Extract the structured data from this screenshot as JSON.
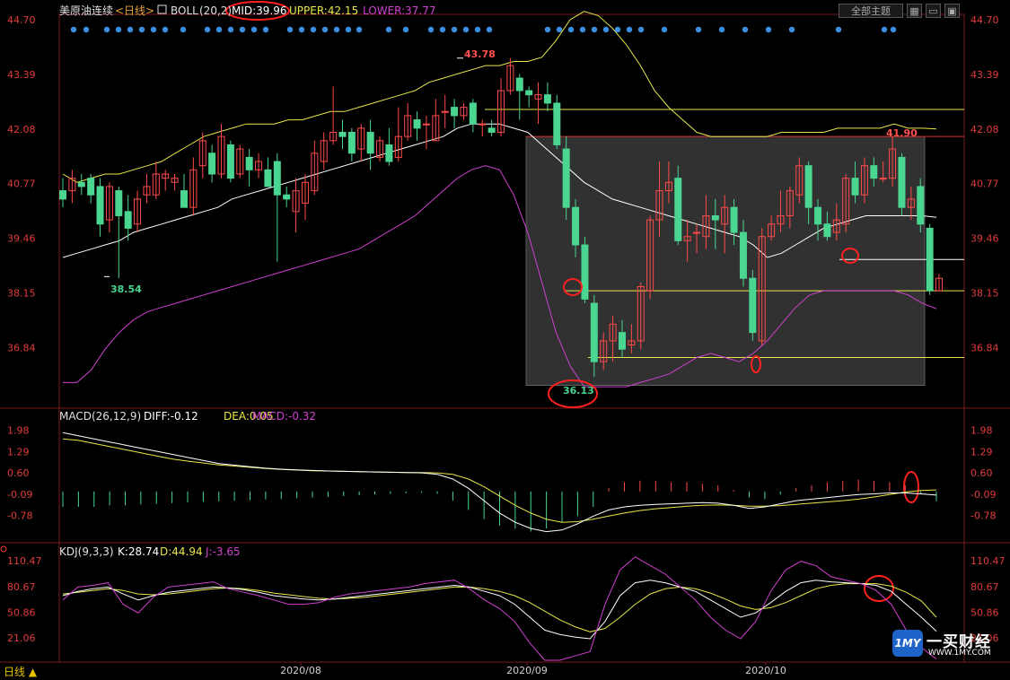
{
  "header": {
    "title": "美原油连续",
    "period_tag": "<日线>",
    "indicator_name": "BOLL",
    "indicator_params": "(20,2)",
    "mid_label": "MID:39.96",
    "upper_label": "UPPER:42.15",
    "lower_label": "LOWER:37.77",
    "theme_button": "全部主题"
  },
  "macd_header": {
    "name": "MACD(26,12,9)",
    "diff": "DIFF:-0.12",
    "dea": "DEA:0.05",
    "macd": "MACD:-0.32"
  },
  "kdj_header": {
    "name": "KDJ(9,3,3)",
    "k": "K:28.74",
    "d": "D:44.94",
    "j": "J:-3.65"
  },
  "annotations": {
    "high_label": "43.78",
    "low_label": "38.54",
    "recent_high_label": "41.90",
    "bottom_label": "36.13"
  },
  "bottom": {
    "period_tab": "日线 ▲"
  },
  "brand": {
    "logo": "1MY",
    "name": "一买财经",
    "url": "WWW.1MY.COM"
  },
  "colors": {
    "up": "#ff4a4a",
    "down": "#4ad590",
    "axis_text": "#e23b3b",
    "upper": "#e8e84a",
    "mid": "#ffffff",
    "lower": "#d040d0",
    "dots": "#3a8fe0"
  },
  "chart_data": [
    {
      "type": "candlestick",
      "title": "美原油连续",
      "x_labels": [
        "2020/08",
        "2020/09",
        "2020/10"
      ],
      "y_ticks": [
        44.7,
        43.39,
        42.08,
        40.77,
        39.46,
        38.15,
        36.84
      ],
      "ylim": [
        35.6,
        44.7
      ],
      "candles": [
        [
          40.6,
          40.4,
          40.9,
          40.2
        ],
        [
          40.6,
          40.9,
          41.1,
          40.3
        ],
        [
          40.8,
          40.7,
          41.0,
          40.5
        ],
        [
          40.9,
          40.5,
          41.0,
          40.3
        ],
        [
          40.7,
          39.8,
          40.9,
          39.5
        ],
        [
          39.9,
          40.7,
          40.8,
          39.6
        ],
        [
          40.6,
          40.0,
          40.7,
          38.5
        ],
        [
          40.1,
          39.7,
          40.5,
          39.4
        ],
        [
          39.8,
          40.4,
          40.6,
          39.6
        ],
        [
          40.5,
          40.7,
          41.0,
          40.3
        ],
        [
          40.5,
          41.0,
          41.3,
          40.4
        ],
        [
          40.9,
          41.0,
          41.1,
          40.6
        ],
        [
          40.8,
          40.9,
          41.0,
          40.6
        ],
        [
          40.6,
          40.2,
          41.0,
          40.2
        ],
        [
          40.2,
          41.1,
          41.4,
          40.0
        ],
        [
          41.2,
          41.8,
          42.0,
          40.9
        ],
        [
          41.5,
          41.0,
          41.7,
          40.8
        ],
        [
          41.0,
          41.9,
          42.2,
          40.9
        ],
        [
          41.7,
          40.9,
          41.8,
          40.8
        ],
        [
          41.0,
          41.6,
          41.7,
          40.9
        ],
        [
          41.4,
          41.1,
          41.6,
          40.7
        ],
        [
          41.1,
          41.3,
          41.5,
          40.9
        ],
        [
          41.1,
          40.7,
          41.4,
          40.7
        ],
        [
          41.3,
          40.5,
          41.5,
          38.9
        ],
        [
          40.5,
          40.4,
          40.7,
          40.2
        ],
        [
          40.1,
          40.6,
          40.9,
          39.6
        ],
        [
          40.3,
          40.8,
          41.0,
          39.9
        ],
        [
          40.6,
          41.5,
          41.8,
          40.5
        ],
        [
          41.3,
          41.8,
          42.0,
          41.1
        ],
        [
          41.8,
          42.0,
          43.1,
          41.7
        ],
        [
          42.0,
          41.9,
          42.3,
          41.6
        ],
        [
          42.0,
          41.5,
          42.1,
          41.3
        ],
        [
          41.6,
          42.1,
          42.2,
          41.3
        ],
        [
          42.0,
          41.5,
          42.3,
          41.1
        ],
        [
          41.4,
          41.8,
          41.9,
          41.3
        ],
        [
          41.7,
          41.3,
          42.1,
          41.2
        ],
        [
          41.4,
          41.9,
          42.6,
          41.3
        ],
        [
          41.9,
          42.4,
          42.7,
          41.8
        ],
        [
          42.3,
          42.1,
          42.5,
          41.8
        ],
        [
          42.2,
          42.2,
          42.4,
          41.6
        ],
        [
          41.8,
          42.4,
          42.8,
          41.8
        ],
        [
          42.5,
          42.5,
          42.9,
          42.1
        ],
        [
          42.6,
          42.4,
          42.8,
          42.1
        ],
        [
          42.4,
          42.6,
          42.7,
          42.3
        ],
        [
          42.7,
          42.2,
          42.8,
          42.0
        ],
        [
          42.2,
          42.2,
          42.3,
          41.9
        ],
        [
          42.1,
          42.0,
          42.3,
          41.9
        ],
        [
          42.0,
          43.0,
          43.3,
          41.9
        ],
        [
          43.0,
          43.6,
          43.78,
          42.9
        ],
        [
          43.3,
          43.0,
          43.4,
          42.3
        ],
        [
          43.0,
          42.9,
          43.1,
          42.6
        ],
        [
          42.8,
          42.9,
          43.2,
          42.2
        ],
        [
          42.9,
          42.7,
          43.2,
          42.5
        ],
        [
          42.7,
          41.7,
          42.9,
          41.6
        ],
        [
          41.6,
          40.2,
          41.9,
          39.9
        ],
        [
          40.2,
          39.3,
          40.4,
          39.0
        ],
        [
          39.3,
          38.0,
          39.5,
          37.9
        ],
        [
          37.9,
          36.5,
          38.1,
          36.13
        ],
        [
          36.5,
          37.0,
          37.2,
          36.3
        ],
        [
          37.0,
          37.4,
          37.6,
          36.5
        ],
        [
          37.2,
          36.8,
          37.5,
          36.6
        ],
        [
          36.9,
          37.0,
          37.4,
          36.7
        ],
        [
          37.0,
          38.3,
          38.4,
          36.8
        ],
        [
          38.2,
          39.9,
          40.0,
          38.0
        ],
        [
          39.9,
          40.6,
          41.3,
          39.5
        ],
        [
          40.6,
          40.8,
          41.3,
          40.3
        ],
        [
          40.9,
          39.4,
          41.2,
          39.3
        ],
        [
          39.4,
          39.5,
          39.9,
          38.9
        ],
        [
          39.6,
          39.6,
          39.8,
          39.1
        ],
        [
          39.5,
          40.0,
          40.5,
          39.2
        ],
        [
          40.0,
          39.9,
          40.4,
          39.2
        ],
        [
          39.8,
          40.2,
          40.5,
          39.1
        ],
        [
          40.2,
          39.6,
          40.4,
          39.3
        ],
        [
          39.6,
          38.5,
          39.9,
          38.3
        ],
        [
          38.5,
          37.2,
          38.7,
          37.0
        ],
        [
          37.0,
          39.5,
          39.7,
          36.9
        ],
        [
          39.5,
          39.8,
          40.0,
          39.4
        ],
        [
          39.8,
          40.0,
          40.6,
          39.6
        ],
        [
          40.0,
          40.6,
          40.7,
          39.7
        ],
        [
          40.5,
          41.2,
          41.4,
          40.3
        ],
        [
          41.2,
          40.2,
          41.3,
          39.8
        ],
        [
          40.2,
          39.8,
          40.4,
          39.4
        ],
        [
          39.8,
          39.5,
          40.1,
          39.4
        ],
        [
          39.6,
          39.9,
          40.3,
          39.4
        ],
        [
          39.8,
          40.9,
          41.0,
          39.6
        ],
        [
          40.9,
          40.5,
          41.3,
          40.3
        ],
        [
          40.5,
          41.2,
          41.4,
          40.3
        ],
        [
          41.2,
          40.9,
          41.4,
          40.7
        ],
        [
          40.9,
          40.9,
          41.3,
          40.8
        ],
        [
          40.9,
          41.6,
          41.9,
          40.7
        ],
        [
          41.4,
          40.2,
          41.5,
          40.0
        ],
        [
          40.2,
          40.4,
          40.7,
          39.9
        ],
        [
          40.7,
          39.8,
          40.9,
          39.6
        ],
        [
          39.7,
          38.2,
          39.8,
          38.1
        ],
        [
          38.2,
          38.5,
          38.6,
          38.2
        ]
      ],
      "boll_upper": [
        41.0,
        40.8,
        40.9,
        41.0,
        41.0,
        41.1,
        41.2,
        41.3,
        41.5,
        41.7,
        41.9,
        42.0,
        42.1,
        42.2,
        42.2,
        42.2,
        42.3,
        42.3,
        42.4,
        42.5,
        42.5,
        42.6,
        42.7,
        42.8,
        42.9,
        43.0,
        43.2,
        43.3,
        43.4,
        43.5,
        43.6,
        43.6,
        43.7,
        43.7,
        43.8,
        44.2,
        44.7,
        44.9,
        44.8,
        44.5,
        44.1,
        43.6,
        43.0,
        42.6,
        42.3,
        42.0,
        41.9,
        41.9,
        41.9,
        41.9,
        41.9,
        42.0,
        42.0,
        42.0,
        42.0,
        42.1,
        42.1,
        42.1,
        42.1,
        42.2,
        42.1,
        42.1,
        42.08
      ],
      "boll_mid": [
        39.0,
        39.1,
        39.2,
        39.3,
        39.4,
        39.6,
        39.7,
        39.8,
        39.9,
        40.0,
        40.1,
        40.2,
        40.4,
        40.5,
        40.6,
        40.7,
        40.8,
        40.9,
        41.0,
        41.1,
        41.2,
        41.3,
        41.4,
        41.5,
        41.6,
        41.7,
        41.8,
        41.9,
        42.1,
        42.2,
        42.2,
        42.2,
        42.1,
        42.0,
        41.7,
        41.4,
        41.1,
        40.8,
        40.6,
        40.4,
        40.3,
        40.2,
        40.1,
        40.0,
        39.9,
        39.8,
        39.7,
        39.6,
        39.5,
        39.3,
        39.0,
        39.1,
        39.3,
        39.5,
        39.7,
        39.8,
        39.9,
        40.0,
        40.0,
        40.0,
        40.0,
        40.0,
        39.96
      ],
      "boll_lower": [
        36.0,
        36.0,
        36.3,
        36.8,
        37.2,
        37.5,
        37.7,
        37.8,
        37.9,
        38.0,
        38.1,
        38.2,
        38.3,
        38.4,
        38.5,
        38.6,
        38.7,
        38.8,
        38.9,
        39.0,
        39.1,
        39.2,
        39.4,
        39.6,
        39.8,
        40.0,
        40.3,
        40.6,
        40.9,
        41.1,
        41.2,
        41.1,
        40.5,
        39.6,
        38.4,
        37.2,
        36.4,
        35.9,
        35.9,
        35.9,
        35.9,
        36.0,
        36.1,
        36.2,
        36.4,
        36.6,
        36.7,
        36.6,
        36.5,
        36.7,
        37.0,
        37.4,
        37.8,
        38.1,
        38.2,
        38.2,
        38.2,
        38.2,
        38.2,
        38.2,
        38.1,
        37.9,
        37.77
      ]
    },
    {
      "type": "bar+line",
      "title": "MACD(26,12,9)",
      "y_ticks": [
        1.98,
        1.29,
        0.6,
        -0.09,
        -0.78
      ],
      "ylim": [
        -1.4,
        2.2
      ],
      "diff": [
        1.9,
        1.8,
        1.7,
        1.6,
        1.5,
        1.4,
        1.3,
        1.2,
        1.1,
        1.0,
        0.9,
        0.85,
        0.8,
        0.75,
        0.72,
        0.7,
        0.68,
        0.66,
        0.65,
        0.64,
        0.63,
        0.62,
        0.61,
        0.6,
        0.55,
        0.4,
        0.1,
        -0.3,
        -0.7,
        -1.0,
        -1.2,
        -1.3,
        -1.25,
        -1.05,
        -0.8,
        -0.6,
        -0.5,
        -0.45,
        -0.42,
        -0.4,
        -0.38,
        -0.36,
        -0.38,
        -0.45,
        -0.55,
        -0.5,
        -0.4,
        -0.3,
        -0.25,
        -0.2,
        -0.15,
        -0.1,
        -0.08,
        -0.05,
        -0.05,
        -0.08,
        -0.12
      ],
      "dea": [
        1.7,
        1.65,
        1.55,
        1.45,
        1.35,
        1.25,
        1.15,
        1.05,
        0.98,
        0.92,
        0.86,
        0.82,
        0.78,
        0.74,
        0.71,
        0.69,
        0.67,
        0.66,
        0.65,
        0.64,
        0.63,
        0.62,
        0.61,
        0.61,
        0.6,
        0.55,
        0.4,
        0.15,
        -0.15,
        -0.45,
        -0.7,
        -0.9,
        -1.0,
        -0.98,
        -0.9,
        -0.8,
        -0.7,
        -0.62,
        -0.56,
        -0.52,
        -0.48,
        -0.45,
        -0.44,
        -0.45,
        -0.48,
        -0.48,
        -0.46,
        -0.42,
        -0.38,
        -0.34,
        -0.3,
        -0.25,
        -0.18,
        -0.1,
        -0.02,
        0.03,
        0.05
      ],
      "macd": [
        -0.5,
        -0.5,
        -0.5,
        -0.45,
        -0.45,
        -0.42,
        -0.4,
        -0.38,
        -0.35,
        -0.34,
        -0.32,
        -0.3,
        -0.28,
        -0.26,
        -0.25,
        -0.22,
        -0.2,
        -0.18,
        -0.15,
        -0.12,
        -0.1,
        -0.08,
        -0.06,
        -0.05,
        -0.08,
        -0.3,
        -0.6,
        -0.9,
        -1.1,
        -1.2,
        -1.3,
        -1.2,
        -1.0,
        -0.8,
        -0.5,
        0.1,
        0.3,
        0.35,
        0.35,
        0.3,
        0.3,
        0.25,
        0.2,
        0.05,
        -0.2,
        -0.25,
        -0.1,
        0.1,
        0.2,
        0.3,
        0.35,
        0.38,
        0.35,
        0.3,
        0.2,
        -0.1,
        -0.32
      ]
    },
    {
      "type": "line",
      "title": "KDJ(9,3,3)",
      "y_ticks": [
        110.47,
        80.67,
        50.86,
        21.06
      ],
      "ylim": [
        -5,
        120
      ],
      "k": [
        70,
        75,
        78,
        80,
        72,
        65,
        70,
        74,
        76,
        78,
        80,
        79,
        77,
        74,
        70,
        68,
        66,
        65,
        66,
        68,
        70,
        72,
        74,
        76,
        78,
        80,
        82,
        80,
        75,
        70,
        60,
        45,
        30,
        25,
        22,
        20,
        40,
        70,
        85,
        88,
        85,
        80,
        75,
        65,
        55,
        45,
        50,
        62,
        75,
        85,
        88,
        86,
        85,
        84,
        82,
        75,
        60,
        45,
        28.74
      ],
      "d": [
        72,
        74,
        76,
        78,
        76,
        72,
        71,
        72,
        74,
        76,
        78,
        79,
        78,
        76,
        73,
        71,
        69,
        67,
        66,
        67,
        68,
        70,
        72,
        74,
        76,
        78,
        80,
        80,
        78,
        75,
        70,
        62,
        52,
        42,
        34,
        28,
        32,
        45,
        60,
        72,
        78,
        80,
        78,
        73,
        66,
        58,
        54,
        56,
        62,
        70,
        78,
        82,
        84,
        84,
        84,
        81,
        74,
        64,
        44.94
      ],
      "j": [
        65,
        80,
        82,
        85,
        60,
        50,
        68,
        80,
        82,
        84,
        86,
        78,
        74,
        70,
        65,
        60,
        60,
        62,
        68,
        72,
        74,
        76,
        78,
        80,
        84,
        86,
        88,
        78,
        65,
        55,
        40,
        15,
        -5,
        -5,
        0,
        5,
        60,
        100,
        115,
        105,
        95,
        80,
        65,
        45,
        30,
        20,
        40,
        75,
        100,
        110,
        105,
        92,
        88,
        84,
        76,
        60,
        30,
        10,
        -3.65
      ]
    }
  ]
}
